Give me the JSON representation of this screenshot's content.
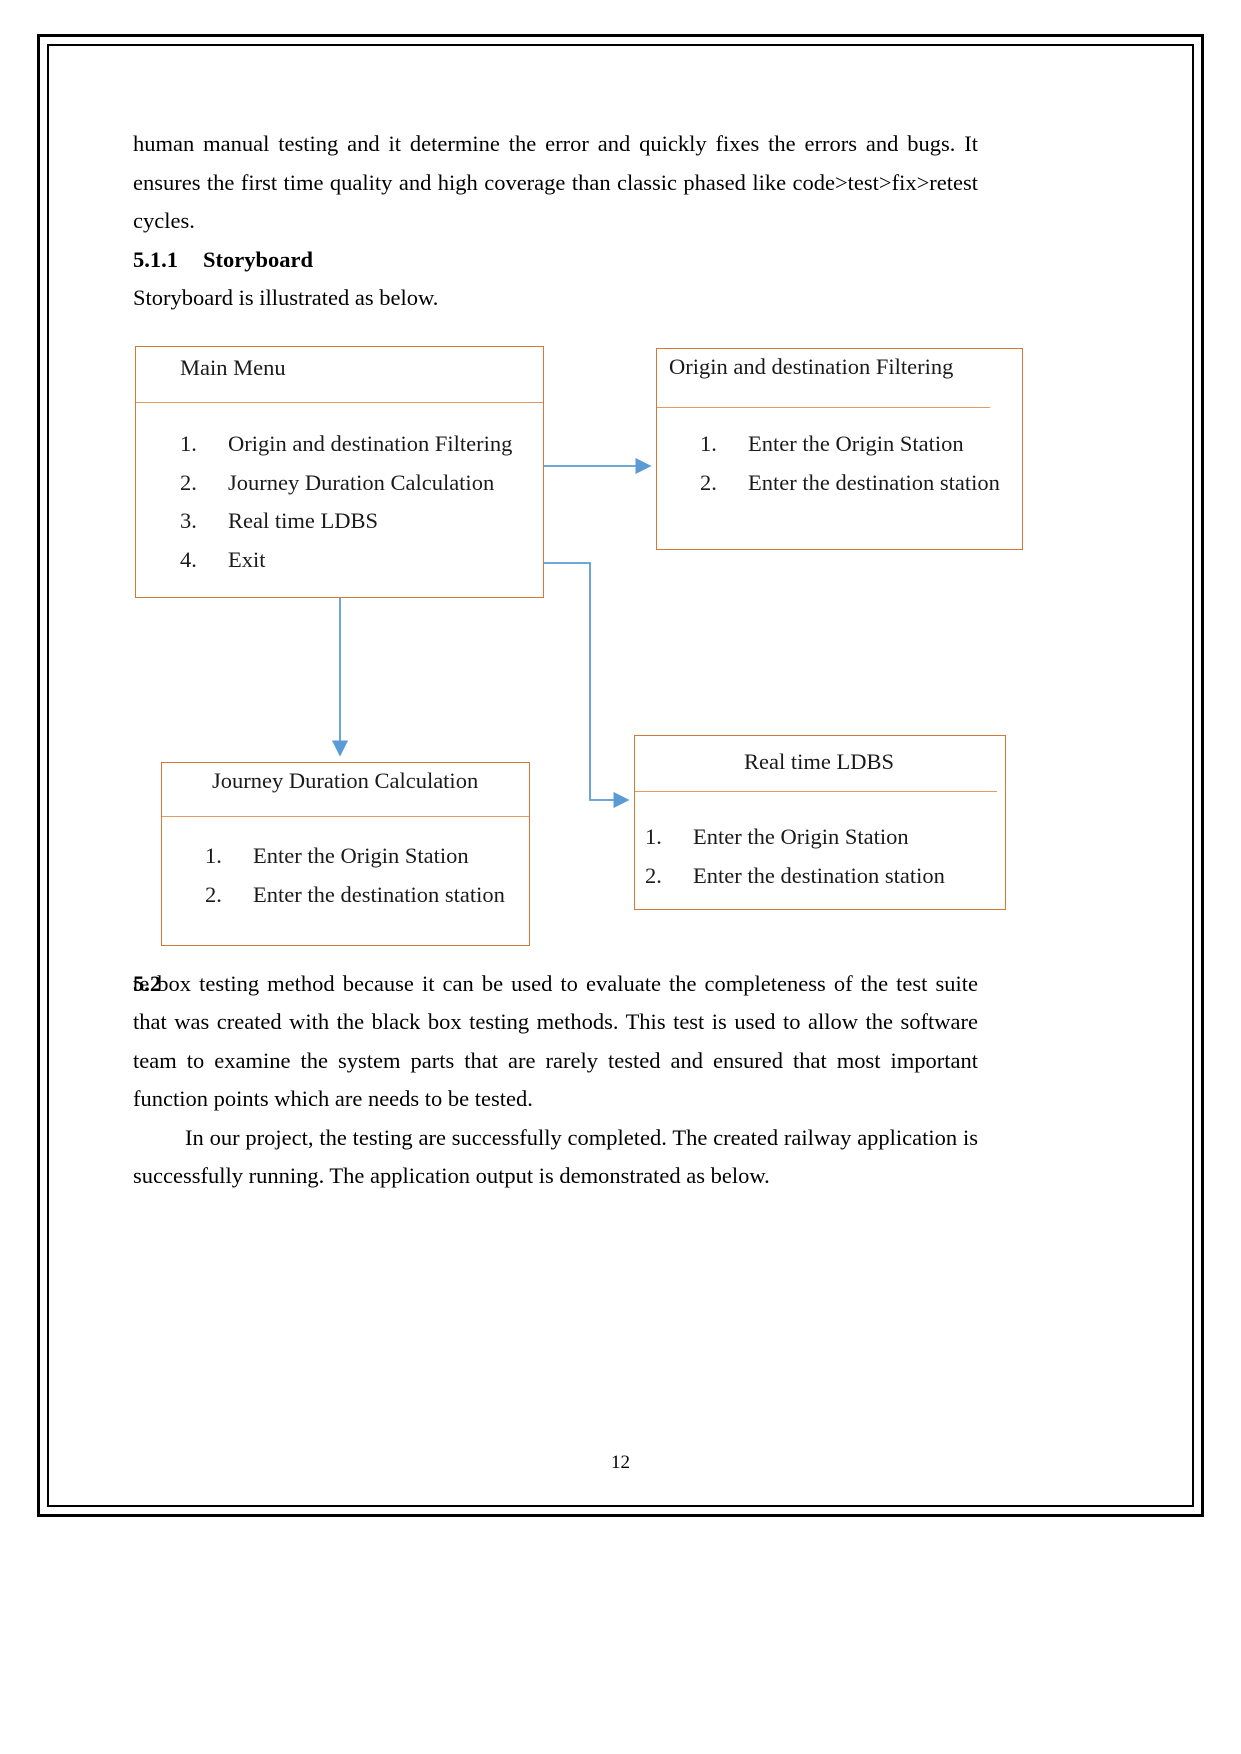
{
  "document": {
    "page_number": "12",
    "paragraphs": {
      "intro": "human manual testing and it determine the error and quickly fixes the errors and bugs. It ensures the first time quality and high coverage than classic phased like code>test>fix>retest cycles.",
      "storyboard_intro": "Storyboard is illustrated as below.",
      "white_box_body": "te box testing method because it can be used to evaluate the completeness of the test suite that was created with the black box testing methods. This test is used to allow the software team to examine the system parts that are rarely tested and ensured that most important function points which are needs to be tested.",
      "conclusion": "In our project, the testing are successfully completed. The created railway application is successfully running. The application output is demonstrated as below."
    },
    "headings": {
      "storyboard": {
        "number": "5.1.1",
        "title": "Storyboard"
      },
      "section_52": {
        "number": "5.2",
        "title": ""
      }
    }
  },
  "storyboard": {
    "colors": {
      "box_border": "#D2793A",
      "separator": "#E09A62",
      "arrow": "#5B9BD5",
      "text": "#1a1a1a"
    },
    "boxes": [
      {
        "id": "main-menu",
        "title": "Main Menu",
        "items": [
          {
            "num": "1.",
            "label": "Origin and destination Filtering"
          },
          {
            "num": "2.",
            "label": "Journey Duration Calculation"
          },
          {
            "num": "3.",
            "label": "Real time LDBS"
          },
          {
            "num": "4.",
            "label": "Exit"
          }
        ]
      },
      {
        "id": "origin-destination-filtering",
        "title": "Origin and destination Filtering",
        "items": [
          {
            "num": "1.",
            "label": "Enter the Origin Station"
          },
          {
            "num": "2.",
            "label": "Enter the destination station"
          }
        ]
      },
      {
        "id": "journey-duration-calculation",
        "title": "Journey Duration Calculation",
        "items": [
          {
            "num": "1.",
            "label": "Enter the Origin Station"
          },
          {
            "num": "2.",
            "label": "Enter the destination station"
          }
        ]
      },
      {
        "id": "real-time-ldbs",
        "title": "Real time LDBS",
        "items": [
          {
            "num": "1.",
            "label": "Enter the Origin Station"
          },
          {
            "num": "2.",
            "label": "Enter the destination station"
          }
        ]
      }
    ],
    "connectors": [
      {
        "from": "main-menu",
        "to": "origin-destination-filtering"
      },
      {
        "from": "main-menu",
        "to": "journey-duration-calculation"
      },
      {
        "from": "main-menu",
        "to": "real-time-ldbs"
      }
    ]
  }
}
